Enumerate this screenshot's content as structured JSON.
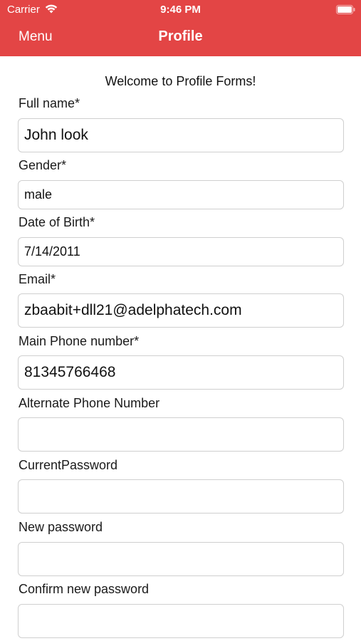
{
  "status_bar": {
    "carrier": "Carrier",
    "time": "9:46 PM"
  },
  "nav": {
    "menu_label": "Menu",
    "title": "Profile",
    "background_color": "#e34545"
  },
  "form": {
    "welcome": "Welcome to Profile Forms!",
    "fields": [
      {
        "label": "Full name*",
        "value": "John look"
      },
      {
        "label": "Gender*",
        "value": "male"
      },
      {
        "label": "Date of Birth*",
        "value": "7/14/2011"
      },
      {
        "label": "Email*",
        "value": "zbaabit+dll21@adelphatech.com"
      },
      {
        "label": "Main Phone number*",
        "value": "81345766468"
      },
      {
        "label": "Alternate Phone Number",
        "value": ""
      },
      {
        "label": "CurrentPassword",
        "value": ""
      },
      {
        "label": "New password",
        "value": ""
      },
      {
        "label": "Confirm new password",
        "value": ""
      }
    ]
  }
}
